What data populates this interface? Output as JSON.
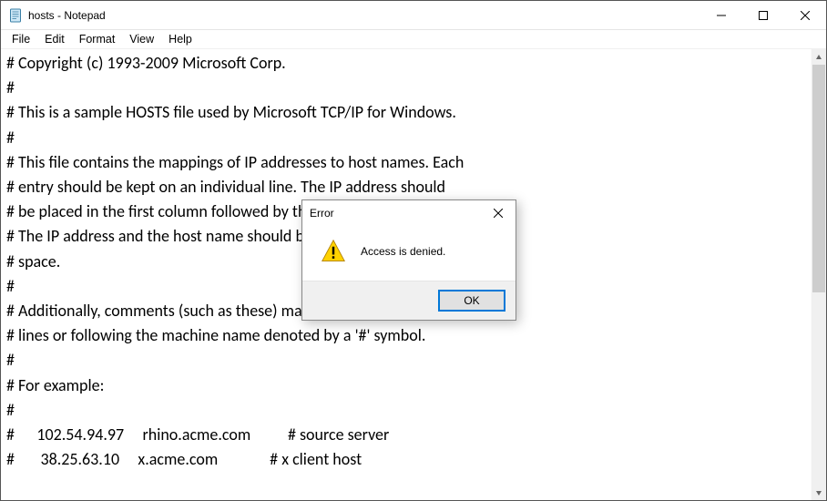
{
  "window": {
    "title": "hosts - Notepad"
  },
  "menu": {
    "file": "File",
    "edit": "Edit",
    "format": "Format",
    "view": "View",
    "help": "Help"
  },
  "editor": {
    "content": "# Copyright (c) 1993-2009 Microsoft Corp.\n#\n# This is a sample HOSTS file used by Microsoft TCP/IP for Windows.\n#\n# This file contains the mappings of IP addresses to host names. Each\n# entry should be kept on an individual line. The IP address should\n# be placed in the first column followed by the corresponding host name.\n# The IP address and the host name should be separated by at least one\n# space.\n#\n# Additionally, comments (such as these) may be inserted on individual\n# lines or following the machine name denoted by a '#' symbol.\n#\n# For example:\n#\n#      102.54.94.97     rhino.acme.com          # source server\n#       38.25.63.10     x.acme.com              # x client host"
  },
  "dialog": {
    "title": "Error",
    "message": "Access is denied.",
    "ok_label": "OK"
  }
}
